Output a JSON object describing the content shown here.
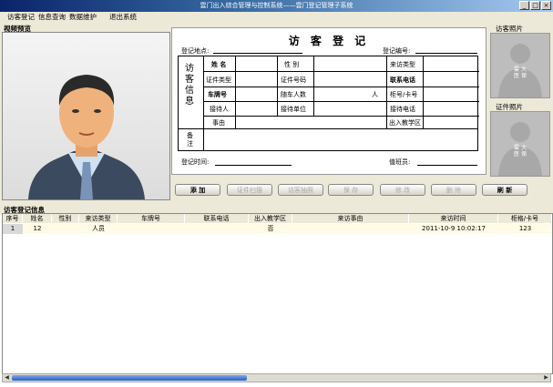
{
  "window": {
    "title": "雲门出入综合管理与控制系统——雲门登记管理子系统"
  },
  "menu": [
    "访客登记",
    "信息查询",
    "数据维护",
    "退出系统"
  ],
  "video": {
    "title": "视频预览"
  },
  "form": {
    "title": "访 客 登 记",
    "location_label": "登记地点:",
    "number_label": "登记编号:",
    "side_label": "访客信息",
    "remark_label": "备注",
    "time_label": "登记时间:",
    "staff_label": "值班员:",
    "fields": {
      "name": "姓 名",
      "gender": "性 别",
      "visit_type": "来访类型",
      "id_type": "证件类型",
      "id_number": "证件号码",
      "phone": "联系电话",
      "plate": "车牌号",
      "companions": "随车人数",
      "person_unit": "人",
      "cabinet": "柜号/卡号",
      "host": "接待人",
      "host_unit": "接待单位",
      "host_phone": "接待电话",
      "reason": "事由",
      "exit": "出入教学区"
    }
  },
  "buttons": [
    {
      "label": "添 加",
      "enabled": true
    },
    {
      "label": "证件扫描",
      "enabled": false
    },
    {
      "label": "访客抽照",
      "enabled": false
    },
    {
      "label": "保 存",
      "enabled": false
    },
    {
      "label": "修 改",
      "enabled": false
    },
    {
      "label": "删 除",
      "enabled": false
    },
    {
      "label": "刷 新",
      "enabled": true
    }
  ],
  "photos": {
    "visitor_title": "访客照片",
    "id_title": "证件照片",
    "watermark": "雲 大 医 保"
  },
  "table": {
    "title": "访客登记信息",
    "columns": [
      "序号",
      "姓名",
      "性别",
      "来访类型",
      "车牌号",
      "联系电话",
      "出入教学区",
      "来访事由",
      "来访时间",
      "柜格/卡号"
    ],
    "rows": [
      [
        "1",
        "12",
        "",
        "人员",
        "",
        "",
        "否",
        "",
        "2011-10-9 10:02:17",
        "123"
      ]
    ]
  },
  "colors": {
    "panel": "#ece9d8",
    "titlebar": "#0a246a",
    "scroll_thumb": "#2b5fc4"
  }
}
